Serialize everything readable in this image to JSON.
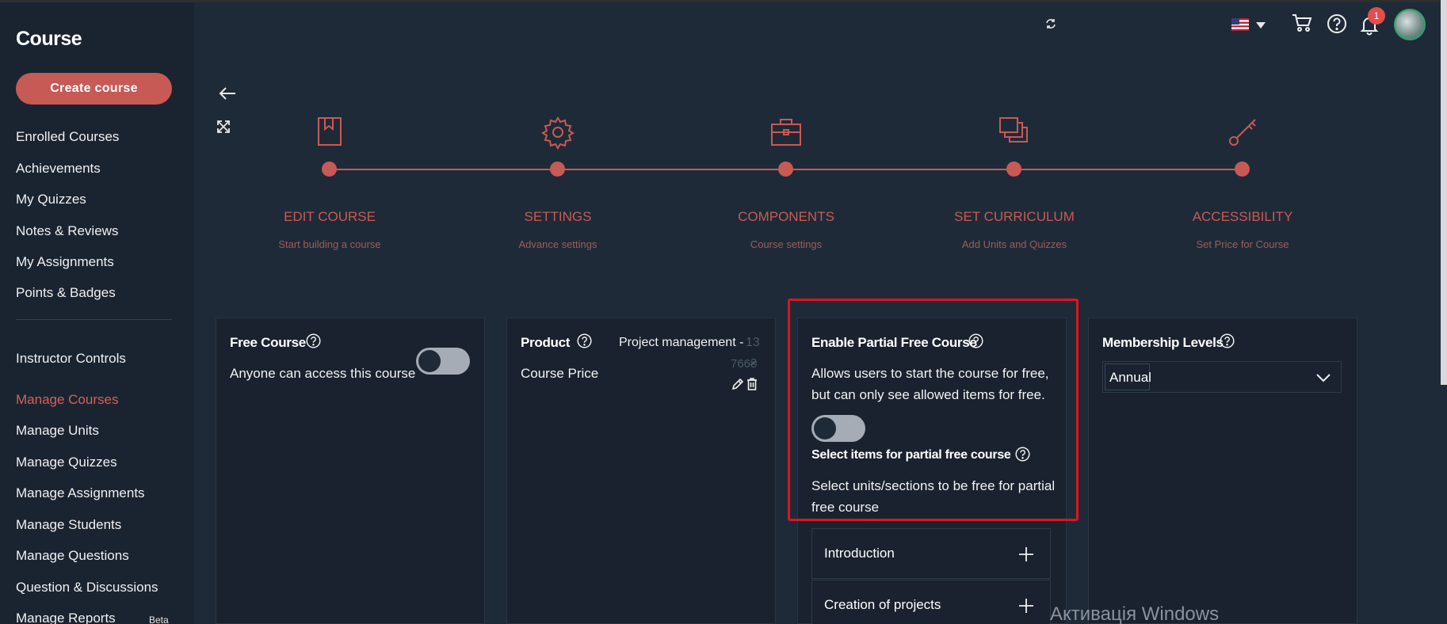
{
  "sidebar": {
    "title": "Course",
    "create_button": "Create course",
    "items_top": [
      "Enrolled Courses",
      "Achievements",
      "My Quizzes",
      "Notes & Reviews",
      "My Assignments",
      "Points & Badges"
    ],
    "section_label": "Instructor Controls",
    "items_bottom": [
      "Manage Courses",
      "Manage Units",
      "Manage Quizzes",
      "Manage Assignments",
      "Manage Students",
      "Manage Questions",
      "Question & Discussions",
      "Manage Reports"
    ],
    "active_item": "Manage Courses",
    "beta_label": "Beta"
  },
  "header": {
    "notification_count": "1",
    "icons": [
      "refresh-icon",
      "flag-us-icon",
      "cart-icon",
      "help-icon",
      "bell-icon",
      "avatar"
    ]
  },
  "stepper": {
    "steps": [
      {
        "title": "EDIT COURSE",
        "subtitle": "Start building a course",
        "icon": "bookmark-book-icon"
      },
      {
        "title": "SETTINGS",
        "subtitle": "Advance settings",
        "icon": "gear-icon"
      },
      {
        "title": "COMPONENTS",
        "subtitle": "Course settings",
        "icon": "briefcase-icon"
      },
      {
        "title": "SET CURRICULUM",
        "subtitle": "Add Units and Quizzes",
        "icon": "layers-icon"
      },
      {
        "title": "ACCESSIBILITY",
        "subtitle": "Set Price for Course",
        "icon": "key-icon"
      }
    ]
  },
  "panels": {
    "free_course": {
      "title": "Free Course",
      "description": "Anyone can access this course",
      "toggle_on": false
    },
    "product": {
      "title": "Product",
      "product_name": "Project management -",
      "product_price_a": "13",
      "product_price_b": "766₴",
      "price_label": "Course Price"
    },
    "partial_free": {
      "title": "Enable Partial Free Course",
      "description_1": "Allows users to start the course for free,",
      "description_2": "but can only see allowed items for free.",
      "toggle_on": false,
      "select_title": "Select items for partial free course",
      "select_desc_1": "Select units/sections to be free for partial",
      "select_desc_2": "free course",
      "sections": [
        "Introduction",
        "Creation of projects"
      ]
    },
    "membership": {
      "title": "Membership Levels",
      "selected": "Annual"
    }
  },
  "watermark": "Активація Windows",
  "colors": {
    "accent": "#c75a54",
    "background": "#1f2a38",
    "sidebar": "#1a2431",
    "highlight": "#e0141e"
  }
}
